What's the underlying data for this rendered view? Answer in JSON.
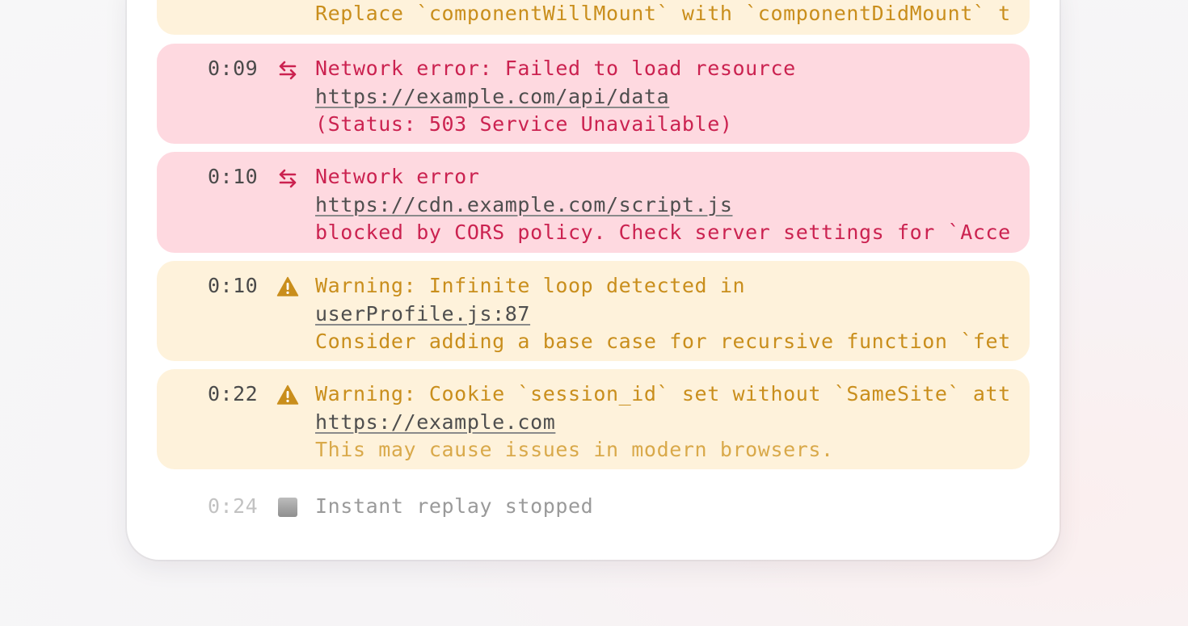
{
  "colors": {
    "warning_bg": "#fef2db",
    "warning_text": "#c98e1c",
    "error_bg": "#fed9e0",
    "error_text": "#cb2250",
    "link_text": "#4e4e4e"
  },
  "entries": [
    {
      "kind": "warning",
      "icon": "warning-triangle-icon",
      "lines": [
        "Replace `componentWillMount` with `componentDidMount` t"
      ]
    },
    {
      "kind": "error",
      "time": "0:09",
      "icon": "network-arrows-icon",
      "message": "Network error: Failed to load resource",
      "link": "https://example.com/api/data",
      "detail": "(Status: 503 Service Unavailable)"
    },
    {
      "kind": "error",
      "time": "0:10",
      "icon": "network-arrows-icon",
      "message": "Network error",
      "link": "https://cdn.example.com/script.js",
      "detail": "blocked by CORS policy. Check server settings for `Acce"
    },
    {
      "kind": "warning",
      "time": "0:10",
      "icon": "warning-triangle-icon",
      "message": "Warning: Infinite loop detected in",
      "link": "userProfile.js:87",
      "detail": "Consider adding a base case for recursive function `fet"
    },
    {
      "kind": "warning",
      "time": "0:22",
      "icon": "warning-triangle-icon",
      "message": "Warning: Cookie `session_id` set without `SameSite` att",
      "link": "https://example.com",
      "detail": "This may cause issues in modern browsers."
    },
    {
      "kind": "status",
      "time": "0:24",
      "icon": "stop-square-icon",
      "message": "Instant replay stopped"
    }
  ]
}
